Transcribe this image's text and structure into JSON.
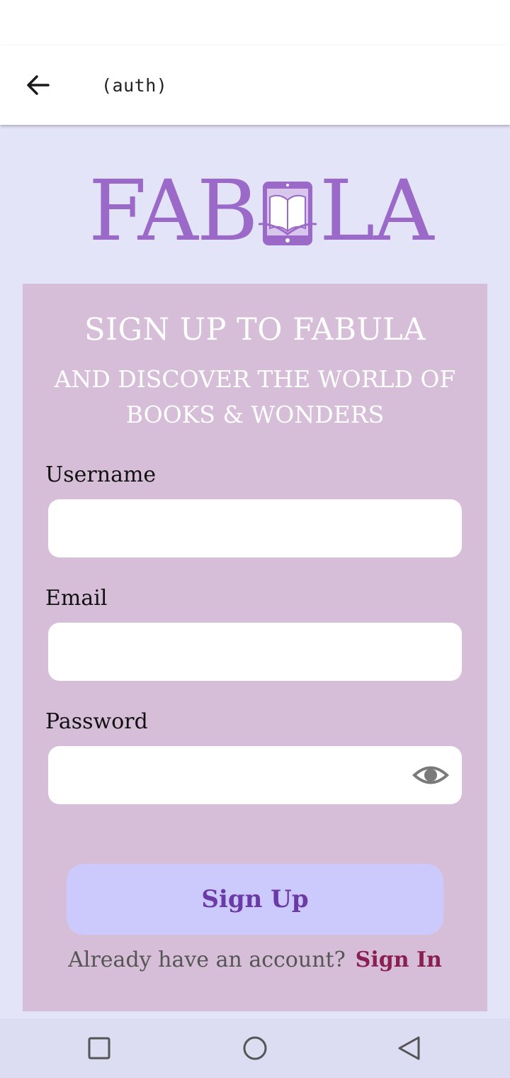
{
  "header": {
    "title": "(auth)",
    "back_icon": "arrow-left-icon"
  },
  "logo": {
    "text_left": "FAB",
    "text_right": "LA",
    "icon": "tablet-book-icon",
    "color": "#9b69c8"
  },
  "card": {
    "title": "SIGN UP TO FABULA",
    "subtitle_line1": "AND DISCOVER THE WORLD OF",
    "subtitle_line2": "BOOKS & WONDERS",
    "background": "#d7bed8"
  },
  "form": {
    "username": {
      "label": "Username",
      "value": "",
      "placeholder": ""
    },
    "email": {
      "label": "Email",
      "value": "",
      "placeholder": ""
    },
    "password": {
      "label": "Password",
      "value": "",
      "placeholder": "",
      "toggle_icon": "eye-icon"
    }
  },
  "signup_button": {
    "label": "Sign Up",
    "background": "#cccafc",
    "text_color": "#6b3aa6"
  },
  "signin_prompt": {
    "text": "Already have an account?",
    "link": "Sign In",
    "link_color": "#8a1f52"
  },
  "navbar": {
    "icons": [
      "recent-apps-icon",
      "home-icon",
      "back-icon"
    ]
  }
}
